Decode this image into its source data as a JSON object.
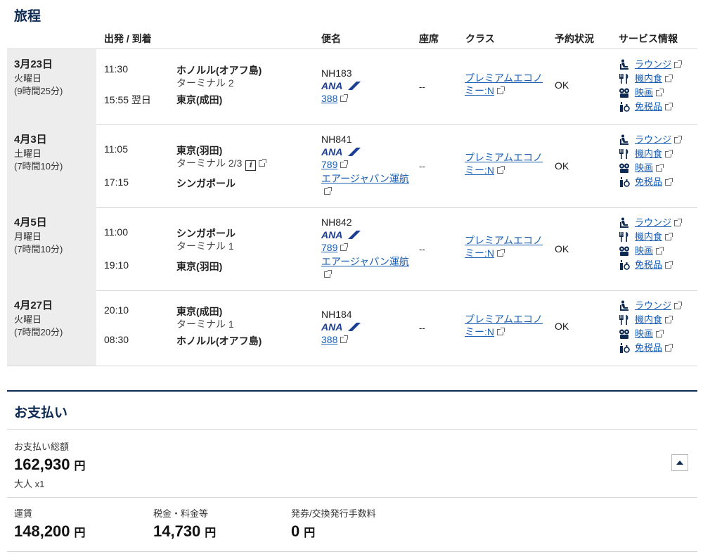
{
  "itinerary": {
    "title": "旅程",
    "headers": {
      "dep_arr": "出発 / 到着",
      "flight": "便名",
      "seat": "座席",
      "class": "クラス",
      "status": "予約状況",
      "services": "サービス情報"
    },
    "ext_icon": "external-link-icon",
    "services": {
      "lounge": "ラウンジ",
      "meal": "機内食",
      "movie": "映画",
      "dutyfree": "免税品"
    },
    "flights": [
      {
        "date": "3月23日",
        "weekday": "火曜日",
        "duration": "(9時間25分)",
        "dep_time": "11:30",
        "dep_place": "ホノルル(オアフ島)",
        "dep_terminal": "ターミナル 2",
        "arr_time": "15:55 翌日",
        "arr_place": "東京(成田)",
        "flight_no": "NH183",
        "airline_logo": "ANA",
        "aircraft": "388",
        "operator": "",
        "seat": "--",
        "class": "プレミアムエコノミー:N",
        "status": "OK"
      },
      {
        "date": "4月3日",
        "weekday": "土曜日",
        "duration": "(7時間10分)",
        "dep_time": "11:05",
        "dep_place": "東京(羽田)",
        "dep_terminal": "ターミナル 2/3",
        "arr_time": "17:15",
        "arr_place": "シンガポール",
        "flight_no": "NH841",
        "airline_logo": "ANA",
        "aircraft": "789",
        "operator": "エアージャパン運航",
        "seat": "--",
        "class": "プレミアムエコノミー:N",
        "status": "OK"
      },
      {
        "date": "4月5日",
        "weekday": "月曜日",
        "duration": "(7時間10分)",
        "dep_time": "11:00",
        "dep_place": "シンガポール",
        "dep_terminal": "ターミナル 1",
        "arr_time": "19:10",
        "arr_place": "東京(羽田)",
        "flight_no": "NH842",
        "airline_logo": "ANA",
        "aircraft": "789",
        "operator": "エアージャパン運航",
        "seat": "--",
        "class": "プレミアムエコノミー:N",
        "status": "OK"
      },
      {
        "date": "4月27日",
        "weekday": "火曜日",
        "duration": "(7時間20分)",
        "dep_time": "20:10",
        "dep_place": "東京(成田)",
        "dep_terminal": "ターミナル 1",
        "arr_time": "08:30",
        "arr_place": "ホノルル(オアフ島)",
        "flight_no": "NH184",
        "airline_logo": "ANA",
        "aircraft": "388",
        "operator": "",
        "seat": "--",
        "class": "プレミアムエコノミー:N",
        "status": "OK"
      }
    ]
  },
  "payment": {
    "title": "お支払い",
    "total_label": "お支払い総額",
    "total_amount": "162,930",
    "currency": "円",
    "passengers": "大人 x1",
    "fare_label": "運賃",
    "fare_amount": "148,200",
    "tax_label": "税金・料金等",
    "tax_amount": "14,730",
    "fee_label": "発券/交換発行手数料",
    "fee_amount": "0"
  },
  "colors": {
    "navy": "#0d2a52",
    "link": "#1a5fb4",
    "date_bg": "#ededed",
    "ana_blue": "#1c3f94"
  }
}
